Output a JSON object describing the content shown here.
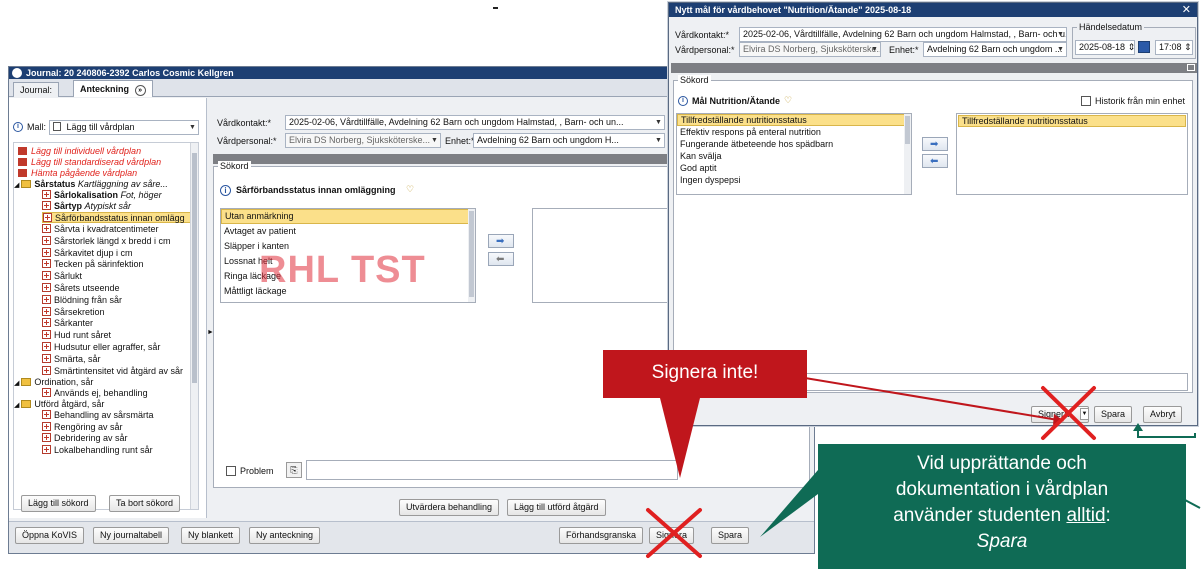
{
  "journal": {
    "title": "Journal: 20 240806-2392 Carlos Cosmic Kellgren",
    "tab_journal": "Journal:",
    "tab_anteckning": "Anteckning",
    "mall_label": "Mall:",
    "mall_value": "Lägg till vårdplan",
    "tree": {
      "red_items": [
        "Lägg till individuell vårdplan",
        "Lägg till standardiserad vårdplan",
        "Hämta pågående vårdplan"
      ],
      "sarstatus": "Sårstatus",
      "sarstatus_note": "Kartläggning av såre...",
      "sarlokalisation": "Sårlokalisation",
      "sarlokalisation_note": "Fot, höger",
      "sartyp": "Sårtyp",
      "sartyp_note": "Atypiskt sår",
      "selected": "Sårförbandsstatus innan omlägg",
      "items": [
        "Sårvta i kvadratcentimeter",
        "Sårstorlek längd x bredd i cm",
        "Sårkavitet djup i cm",
        "Tecken på särinfektion",
        "Sårlukt",
        "Sårets utseende",
        "Blödning från sår",
        "Sårsekretion",
        "Sårkanter",
        "Hud runt såret",
        "Hudsutur eller agraffer, sår",
        "Smärta, sår",
        "Smärtintensitet vid åtgärd av sår"
      ],
      "ordination": "Ordination, sår",
      "ordination_item": "Används ej, behandling",
      "utford": "Utförd åtgärd, sår",
      "utford_items": [
        "Behandling av sårsmärta",
        "Rengöring av sår",
        "Debridering av sår",
        "Lokalbehandling runt sår"
      ]
    },
    "vardkontakt_label": "Vårdkontakt:*",
    "vardkontakt_value": "2025-02-06, Vårdtillfälle, Avdelning 62 Barn och ungdom Halmstad, , Barn- och un...",
    "vardpersonal_label": "Vårdpersonal:*",
    "vardpersonal_value": "Elvira DS Norberg, Sjuksköterske...",
    "enhet_label": "Enhet:*",
    "enhet_value": "Avdelning 62 Barn och ungdom H...",
    "sokord_legend": "Sökord",
    "term_title": "Sårförbandsstatus innan omläggning",
    "options": [
      "Utan anmärkning",
      "Avtaget av patient",
      "Släpper i kanten",
      "Lossnat helt",
      "Ringa läckage",
      "Måttligt läckage"
    ],
    "watermark": "RHL TST",
    "problem_label": "Problem",
    "btn_lagg_till_sokord": "Lägg till sökord",
    "btn_ta_bort_sokord": "Ta bort sökord",
    "btn_utvardera": "Utvärdera behandling",
    "btn_lagg_till_utford": "Lägg till utförd åtgärd",
    "btn_oppna_kovis": "Öppna KoVIS",
    "btn_ny_journaltabell": "Ny journaltabell",
    "btn_ny_blankett": "Ny blankett",
    "btn_ny_anteckning": "Ny anteckning",
    "btn_forhandsgranska": "Förhandsgranska",
    "btn_signera": "Signera",
    "btn_spara": "Spara",
    "partial_h": "H",
    "partial_2": "2"
  },
  "dialog": {
    "title": "Nytt mål för vårdbehovet \"Nutrition/Ätande\" 2025-08-18",
    "vardkontakt_label": "Vårdkontakt:*",
    "vardkontakt_value": "2025-02-06, Vårdtillfälle, Avdelning 62 Barn och ungdom Halmstad, , Barn- och u...",
    "vardpersonal_label": "Vårdpersonal:*",
    "vardpersonal_value": "Elvira DS Norberg, Sjuksköterske...",
    "enhet_label": "Enhet:*",
    "enhet_value": "Avdelning 62 Barn och ungdom ...",
    "handelsedatum_label": "Händelsedatum",
    "date_value": "2025-08-18",
    "time_value": "17:08",
    "sokord_legend": "Sökord",
    "term_title": "Mål Nutrition/Ätande",
    "historik_label": "Historik från min enhet",
    "options": [
      "Tillfredställande nutritionsstatus",
      "Effektiv respons på enteral nutrition",
      "Fungerande ätbeteende hos spädbarn",
      "Kan svälja",
      "God aptit",
      "Ingen dyspepsi"
    ],
    "selected_value": "Tillfredställande nutritionsstatus",
    "btn_signera": "Signera",
    "btn_spara": "Spara",
    "btn_avbryt": "Avbryt"
  },
  "callouts": {
    "red": "Signera inte!",
    "green_line1": "Vid upprättande och",
    "green_line2": "dokumentation i vårdplan",
    "green_line3_pre": "använder studenten ",
    "green_line3_u": "alltid",
    "green_line3_post": ":",
    "green_line4": "Spara"
  },
  "colors": {
    "title_bar": "#1d3f73",
    "red_callout": "#c0161c",
    "green_callout": "#0f6b55",
    "selection": "#fbe08a"
  }
}
